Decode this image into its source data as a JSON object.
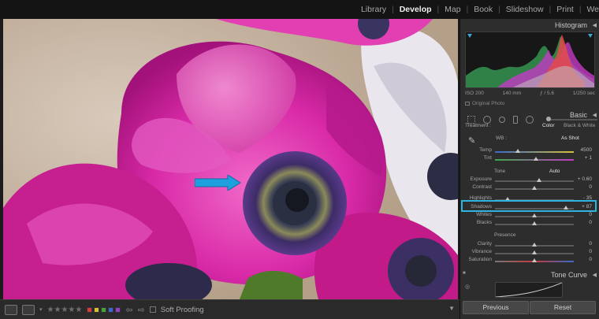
{
  "modules": [
    "Library",
    "Develop",
    "Map",
    "Book",
    "Slideshow",
    "Print",
    "We"
  ],
  "active_module": "Develop",
  "colors": {
    "accent_highlight": "#2fb3e0",
    "annotation_arrow": "#1ea0de",
    "flag_red": "#d93b3b",
    "flag_yellow": "#d6c030",
    "flag_green": "#3ea63b",
    "flag_blue": "#3b68d6",
    "flag_purple": "#9640c8"
  },
  "toolbar": {
    "rating_stars": "★★★★★",
    "soft_proofing_label": "Soft Proofing",
    "soft_proofing_checked": false
  },
  "histogram": {
    "title": "Histogram",
    "iso": "ISO 200",
    "focal": "140 mm",
    "aperture": "ƒ / 5.6",
    "shutter": "1/250 sec",
    "original_photo_label": "Original Photo"
  },
  "basic": {
    "title": "Basic",
    "treatment_label": "Treatment :",
    "treatment_color": "Color",
    "treatment_bw": "Black & White",
    "wb_label": "WB :",
    "wb_value": "As Shot",
    "temp_label": "Temp",
    "temp_value": "4500",
    "tint_label": "Tint",
    "tint_value": "+ 1",
    "tone_label": "Tone",
    "auto_label": "Auto",
    "exposure_label": "Exposure",
    "exposure_value": "+ 0.60",
    "contrast_label": "Contrast",
    "contrast_value": "0",
    "highlights_label": "Highlights",
    "highlights_value": "- 35",
    "shadows_label": "Shadows",
    "shadows_value": "+ 87",
    "whites_label": "Whites",
    "whites_value": "0",
    "blacks_label": "Blacks",
    "blacks_value": "0",
    "presence_label": "Presence",
    "clarity_label": "Clarity",
    "clarity_value": "0",
    "vibrance_label": "Vibrance",
    "vibrance_value": "0",
    "saturation_label": "Saturation",
    "saturation_value": "0"
  },
  "tone_curve": {
    "title": "Tone Curve"
  },
  "buttons": {
    "previous": "Previous",
    "reset": "Reset"
  }
}
